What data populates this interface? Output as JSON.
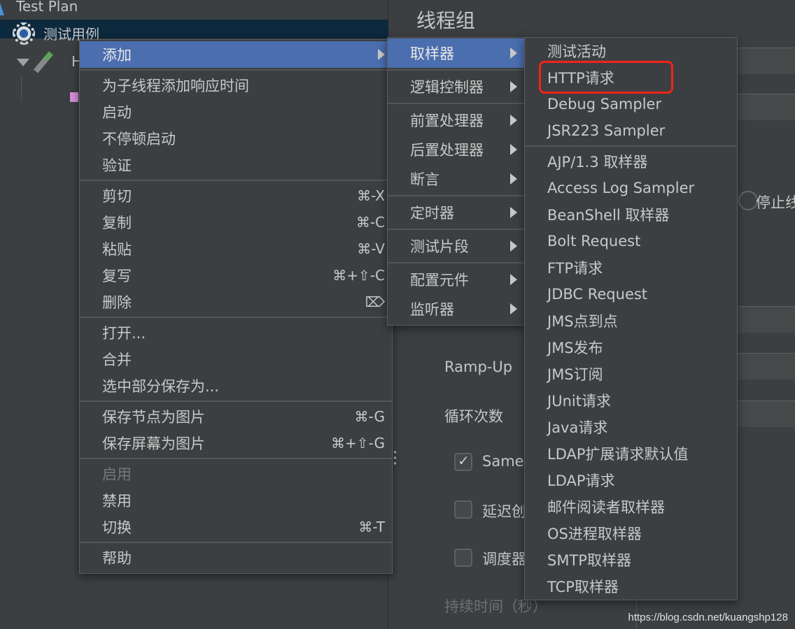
{
  "tree": {
    "root": "Test Plan",
    "thread_group": "测试用例",
    "child_partial": "H"
  },
  "panel": {
    "title": "线程组",
    "ramp_up": "Ramp-Up",
    "loop_count": "循环次数",
    "same_user": "Same",
    "delay_create": "延迟创",
    "scheduler": "调度器",
    "duration": "持续时间（秒）",
    "stop_partial": "停止线",
    "same_user_checked": true,
    "delay_checked": false,
    "scheduler_checked": false
  },
  "menu_main": [
    {
      "label": "添加",
      "submenu": true,
      "highlighted": true
    },
    {
      "separator": true
    },
    {
      "label": "为子线程添加响应时间"
    },
    {
      "label": "启动"
    },
    {
      "label": "不停顿启动"
    },
    {
      "label": "验证"
    },
    {
      "separator": true
    },
    {
      "label": "剪切",
      "shortcut": "⌘-X"
    },
    {
      "label": "复制",
      "shortcut": "⌘-C"
    },
    {
      "label": "粘贴",
      "shortcut": "⌘-V"
    },
    {
      "label": "复写",
      "shortcut": "⌘+⇧-C"
    },
    {
      "label": "删除",
      "shortcut": "⌦"
    },
    {
      "separator": true
    },
    {
      "label": "打开..."
    },
    {
      "label": "合并"
    },
    {
      "label": "选中部分保存为..."
    },
    {
      "separator": true
    },
    {
      "label": "保存节点为图片",
      "shortcut": "⌘-G"
    },
    {
      "label": "保存屏幕为图片",
      "shortcut": "⌘+⇧-G"
    },
    {
      "separator": true
    },
    {
      "label": "启用",
      "disabled": true
    },
    {
      "label": "禁用"
    },
    {
      "label": "切换",
      "shortcut": "⌘-T"
    },
    {
      "separator": true
    },
    {
      "label": "帮助"
    }
  ],
  "menu_add": [
    {
      "label": "取样器",
      "submenu": true,
      "highlighted": true
    },
    {
      "separator": true
    },
    {
      "label": "逻辑控制器",
      "submenu": true
    },
    {
      "separator": true
    },
    {
      "label": "前置处理器",
      "submenu": true
    },
    {
      "label": "后置处理器",
      "submenu": true
    },
    {
      "label": "断言",
      "submenu": true
    },
    {
      "separator": true
    },
    {
      "label": "定时器",
      "submenu": true
    },
    {
      "separator": true
    },
    {
      "label": "测试片段",
      "submenu": true
    },
    {
      "separator": true
    },
    {
      "label": "配置元件",
      "submenu": true
    },
    {
      "label": "监听器",
      "submenu": true
    }
  ],
  "menu_sampler": [
    {
      "label": "测试活动"
    },
    {
      "label": "HTTP请求",
      "annotated": true
    },
    {
      "label": "Debug Sampler"
    },
    {
      "label": "JSR223 Sampler"
    },
    {
      "separator": true
    },
    {
      "label": "AJP/1.3 取样器"
    },
    {
      "label": "Access Log Sampler"
    },
    {
      "label": "BeanShell 取样器"
    },
    {
      "label": "Bolt Request"
    },
    {
      "label": "FTP请求"
    },
    {
      "label": "JDBC Request"
    },
    {
      "label": "JMS点到点"
    },
    {
      "label": "JMS发布"
    },
    {
      "label": "JMS订阅"
    },
    {
      "label": "JUnit请求"
    },
    {
      "label": "Java请求"
    },
    {
      "label": "LDAP扩展请求默认值"
    },
    {
      "label": "LDAP请求"
    },
    {
      "label": "邮件阅读者取样器"
    },
    {
      "label": "OS进程取样器"
    },
    {
      "label": "SMTP取样器"
    },
    {
      "label": "TCP取样器"
    }
  ],
  "annotation_color": "#f2231b",
  "highlight_color": "#4b6eaf",
  "watermark": "https://blog.csdn.net/kuangshp128"
}
